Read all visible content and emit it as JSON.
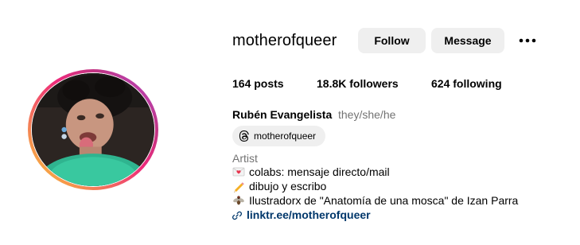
{
  "profile": {
    "username": "motherofqueer",
    "full_name": "Rubén Evangelista",
    "pronouns": "they/she/he",
    "category": "Artist",
    "avatar_icon": "profile-photo"
  },
  "actions": {
    "follow_label": "Follow",
    "message_label": "Message",
    "more_icon": "more-options-icon"
  },
  "stats": {
    "posts_count": "164",
    "posts_label": " posts",
    "followers_count": "18.8K",
    "followers_label": " followers",
    "following_count": "624",
    "following_label": " following"
  },
  "threads": {
    "label": "motherofqueer",
    "icon": "threads-icon"
  },
  "bio": {
    "lines": [
      {
        "emoji": "love-letter-icon",
        "text": "colabs: mensaje directo/mail"
      },
      {
        "emoji": "pencil-icon",
        "text": "dibujo y escribo"
      },
      {
        "emoji": "fly-icon",
        "text": "Ilustradorx de \"Anatomía de una mosca\" de Izan Parra"
      }
    ]
  },
  "link": {
    "icon": "link-icon",
    "text": "linktr.ee/motherofqueer"
  },
  "colors": {
    "button_bg": "#efefef",
    "link": "#00376b",
    "secondary_text": "#737373",
    "ring_start": "#f9ce34",
    "ring_mid": "#ee2a7b",
    "ring_end": "#b04bd6"
  }
}
